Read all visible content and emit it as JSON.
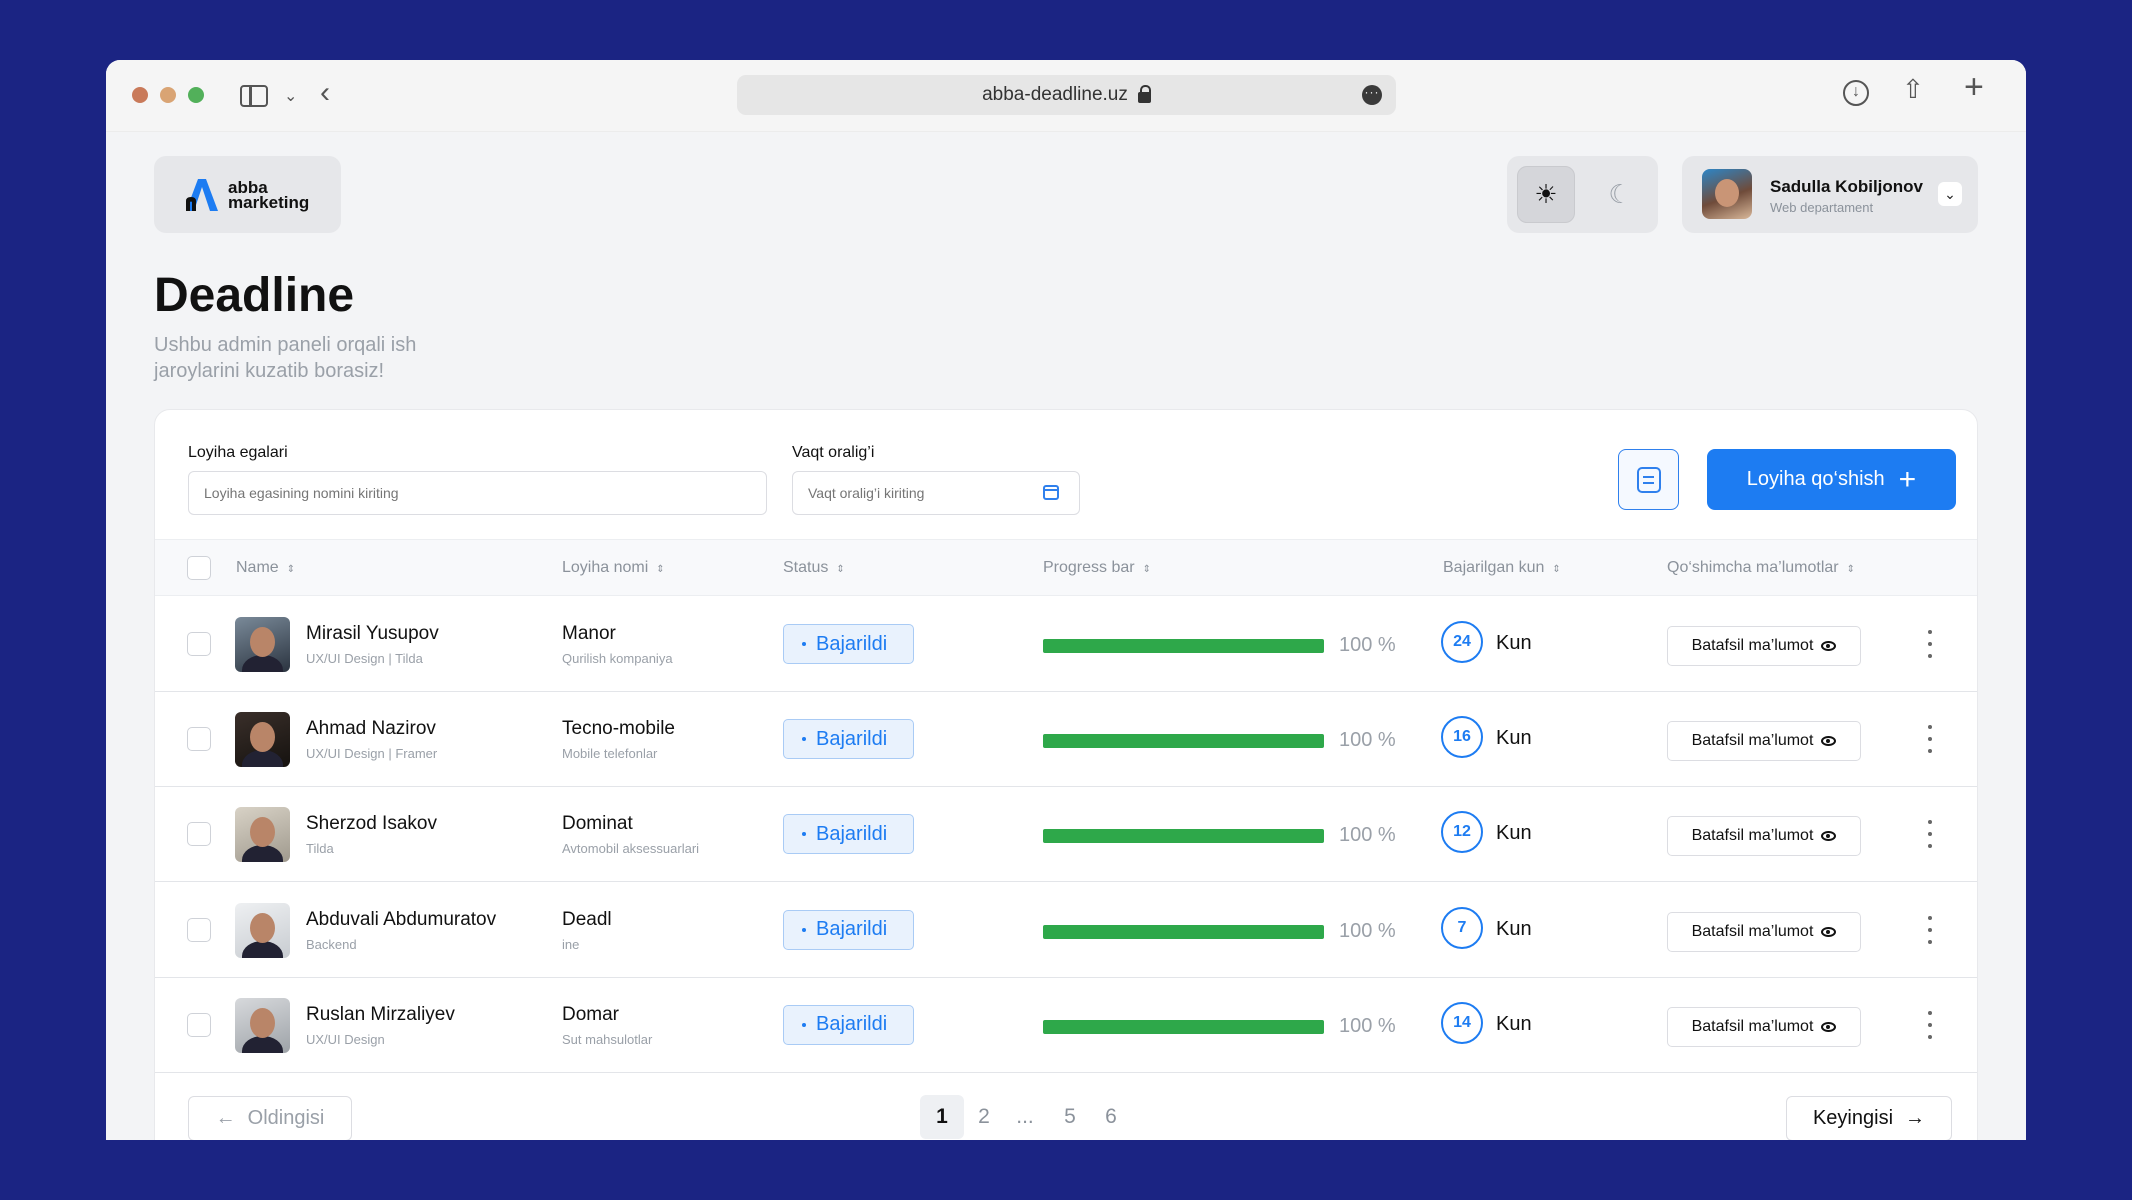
{
  "browser": {
    "url": "abba-deadline.uz"
  },
  "header": {
    "logo_line1": "abba",
    "logo_line2": "marketing",
    "user_name": "Sadulla Kobiljonov",
    "user_dept": "Web departament"
  },
  "page": {
    "title": "Deadline",
    "subtitle": "Ushbu admin paneli orqali ish jaroylarini kuzatib borasiz!"
  },
  "filters": {
    "owner_label": "Loyiha egalari",
    "owner_placeholder": "Loyiha egasining nomini kiriting",
    "time_label": "Vaqt oralig’i",
    "time_placeholder": "Vaqt oralig’i kiriting",
    "add_button": "Loyiha qo‘shish"
  },
  "table": {
    "columns": [
      "Name",
      "Loyiha nomi",
      "Status",
      "Progress bar",
      "Bajarilgan kun",
      "Qo‘shimcha ma’lumotlar"
    ],
    "rows": [
      {
        "name": "Mirasil Yusupov",
        "role": "UX/UI Design | Tilda",
        "project": "Manor",
        "project_sub": "Qurilish kompaniya",
        "status": "Bajarildi",
        "progress": 100,
        "progress_text": "100 %",
        "days": "24",
        "days_unit": "Kun",
        "detail": "Batafsil ma’lumot"
      },
      {
        "name": "Ahmad Nazirov",
        "role": "UX/UI Design | Framer",
        "project": "Tecno-mobile",
        "project_sub": "Mobile telefonlar",
        "status": "Bajarildi",
        "progress": 100,
        "progress_text": "100 %",
        "days": "16",
        "days_unit": "Kun",
        "detail": "Batafsil ma’lumot"
      },
      {
        "name": "Sherzod Isakov",
        "role": "Tilda",
        "project": "Dominat",
        "project_sub": "Avtomobil aksessuarlari",
        "status": "Bajarildi",
        "progress": 100,
        "progress_text": "100 %",
        "days": "12",
        "days_unit": "Kun",
        "detail": "Batafsil ma’lumot"
      },
      {
        "name": "Abduvali Abdumuratov",
        "role": "Backend",
        "project": "Deadl",
        "project_sub": "ine",
        "status": "Bajarildi",
        "progress": 100,
        "progress_text": "100 %",
        "days": "7",
        "days_unit": "Kun",
        "detail": "Batafsil ma’lumot"
      },
      {
        "name": "Ruslan Mirzaliyev",
        "role": "UX/UI Design",
        "project": "Domar",
        "project_sub": "Sut mahsulotlar",
        "status": "Bajarildi",
        "progress": 100,
        "progress_text": "100 %",
        "days": "14",
        "days_unit": "Kun",
        "detail": "Batafsil ma’lumot"
      }
    ]
  },
  "pagination": {
    "prev": "Oldingisi",
    "next": "Keyingisi",
    "pages": [
      "1",
      "2",
      "...",
      "5",
      "6"
    ],
    "current": "1"
  },
  "colors": {
    "background": "#1b2483",
    "accent": "#1d7cf2",
    "progress": "#2ea84a"
  }
}
